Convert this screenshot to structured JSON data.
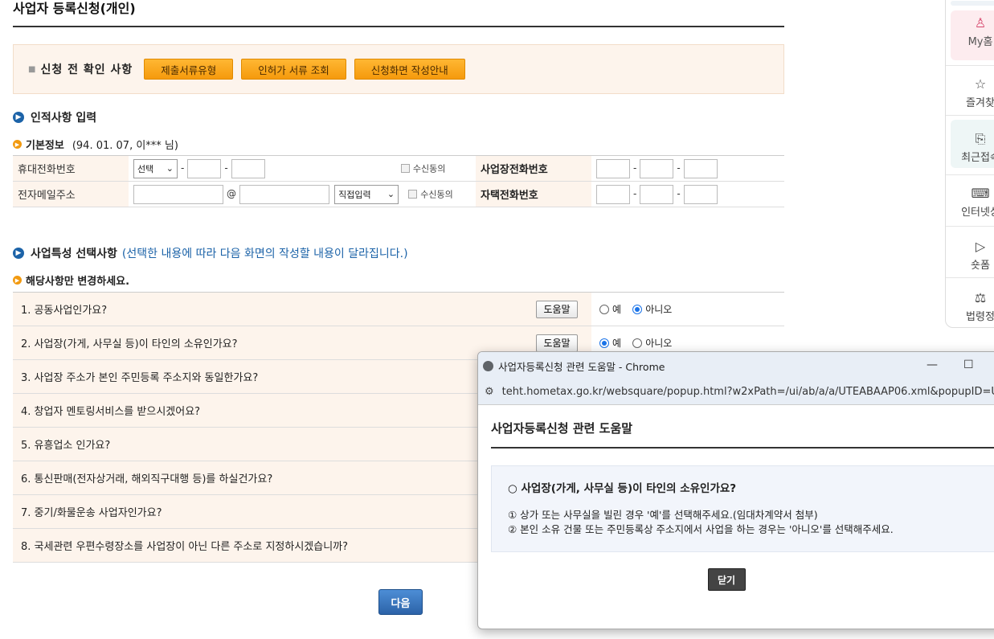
{
  "page": {
    "title": "사업자 등록신청(개인)"
  },
  "confirm": {
    "label": "신청 전 확인 사항",
    "buttons": [
      "제출서류유형",
      "인허가 서류 조회",
      "신청화면 작성안내"
    ]
  },
  "personal": {
    "section_title": "인적사항 입력",
    "basic_label": "기본정보",
    "basic_extra": "(94. 01. 07, 이*** 님)",
    "mobile_label": "휴대전화번호",
    "mobile_select": "선택",
    "consent_label": "수신동의",
    "biz_phone_label": "사업장전화번호",
    "email_label": "전자메일주소",
    "email_at": "@",
    "email_select": "직접입력",
    "home_phone_label": "자택전화번호",
    "dash": "-"
  },
  "business": {
    "section_title": "사업특성 선택사항",
    "section_note": "(선택한 내용에 따라 다음 화면의 작성할 내용이 달라집니다.)",
    "sub_title": "해당사항만 변경하세요.",
    "help_label": "도움말",
    "yes_label": "예",
    "no_label": "아니오",
    "questions": [
      {
        "text": "1. 공동사업인가요?",
        "answer": "no"
      },
      {
        "text": "2. 사업장(가게, 사무실 등)이 타인의 소유인가요?",
        "answer": "yes"
      },
      {
        "text": "3. 사업장 주소가 본인 주민등록 주소지와 동일한가요?"
      },
      {
        "text": "4. 창업자 멘토링서비스를 받으시겠어요?"
      },
      {
        "text": "5. 유흥업소 인가요?"
      },
      {
        "text": "6. 통신판매(전자상거래, 해외직구대행 등)를 하실건가요?"
      },
      {
        "text": "7. 중기/화물운송 사업자인가요?"
      },
      {
        "text": "8. 국세관련 우편수령장소를 사업장이 아닌 다른 주소로 지정하시겠습니까?"
      }
    ]
  },
  "next_label": "다음",
  "side_panel": {
    "items": [
      "My홈",
      "즐겨찾",
      "최근접속",
      "인터넷상",
      "숏폼",
      "법령정"
    ]
  },
  "popup": {
    "window_title": "사업자등록신청 관련 도움말 - Chrome",
    "url": "teht.hometax.go.kr/websquare/popup.html?w2xPath=/ui/ab/a/a/UTEABAAP06.xml&popupID=U",
    "heading": "사업자등록신청 관련 도움말",
    "question": "사업장(가게, 사무실 등)이 타인의 소유인가요?",
    "lines": [
      "① 상가 또는 사무실을 빌린 경우 '예'를 선택해주세요.(임대차계약서 첨부)",
      "② 본인 소유 건물 또는 주민등록상 주소지에서 사업을 하는 경우는 '아니오'를 선택해주세요."
    ],
    "close_label": "닫기"
  }
}
